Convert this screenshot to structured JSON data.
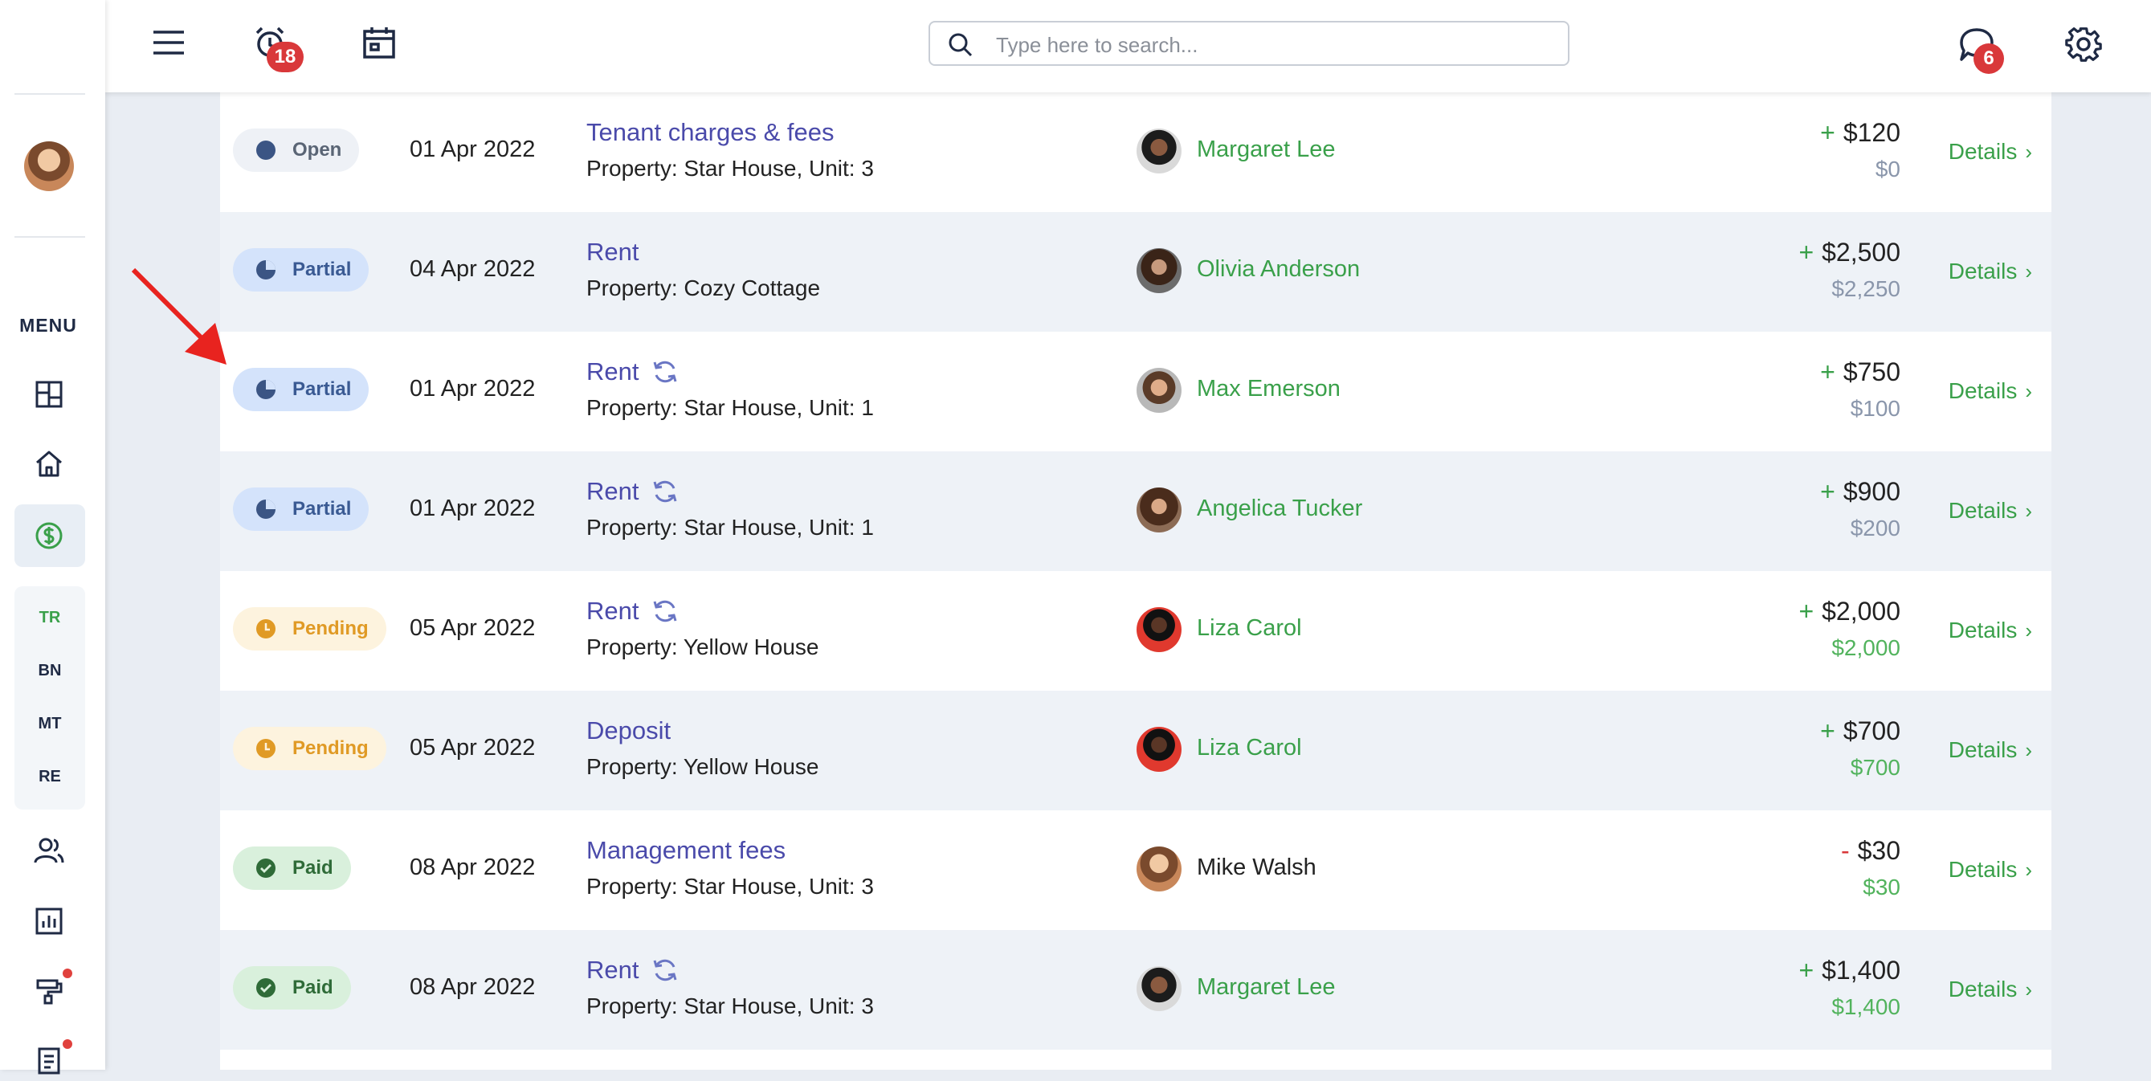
{
  "header": {
    "search_placeholder": "Type here to search...",
    "alerts_count": "18",
    "messages_count": "6"
  },
  "sidebar": {
    "menu_label": "MENU",
    "sub_items": [
      "TR",
      "BN",
      "MT",
      "RE"
    ]
  },
  "transactions": [
    {
      "status": "Open",
      "date": "01 Apr 2022",
      "title": "Tenant charges & fees",
      "recurring": false,
      "property": "Property: Star House, Unit: 3",
      "tenant": "Margaret Lee",
      "sign": "+",
      "amount": "$120",
      "balance": "$0",
      "details": "Details"
    },
    {
      "status": "Partial",
      "date": "04 Apr 2022",
      "title": "Rent",
      "recurring": false,
      "property": "Property: Cozy Cottage",
      "tenant": "Olivia Anderson",
      "sign": "+",
      "amount": "$2,500",
      "balance": "$2,250",
      "details": "Details"
    },
    {
      "status": "Partial",
      "date": "01 Apr 2022",
      "title": "Rent",
      "recurring": true,
      "property": "Property: Star House, Unit: 1",
      "tenant": "Max Emerson",
      "sign": "+",
      "amount": "$750",
      "balance": "$100",
      "details": "Details"
    },
    {
      "status": "Partial",
      "date": "01 Apr 2022",
      "title": "Rent",
      "recurring": true,
      "property": "Property: Star House, Unit: 1",
      "tenant": "Angelica Tucker",
      "sign": "+",
      "amount": "$900",
      "balance": "$200",
      "details": "Details"
    },
    {
      "status": "Pending",
      "date": "05 Apr 2022",
      "title": "Rent",
      "recurring": true,
      "property": "Property: Yellow House",
      "tenant": "Liza Carol",
      "sign": "+",
      "amount": "$2,000",
      "balance": "$2,000",
      "details": "Details"
    },
    {
      "status": "Pending",
      "date": "05 Apr 2022",
      "title": "Deposit",
      "recurring": false,
      "property": "Property: Yellow House",
      "tenant": "Liza Carol",
      "sign": "+",
      "amount": "$700",
      "balance": "$700",
      "details": "Details"
    },
    {
      "status": "Paid",
      "date": "08 Apr 2022",
      "title": "Management fees",
      "recurring": false,
      "property": "Property: Star House, Unit: 3",
      "tenant": "Mike Walsh",
      "sign": "-",
      "amount": "$30",
      "balance": "$30",
      "details": "Details"
    },
    {
      "status": "Paid",
      "date": "08 Apr 2022",
      "title": "Rent",
      "recurring": true,
      "property": "Property: Star House, Unit: 3",
      "tenant": "Margaret Lee",
      "sign": "+",
      "amount": "$1,400",
      "balance": "$1,400",
      "details": "Details"
    }
  ],
  "colors": {
    "accent_green": "#3aa04a",
    "link_purple": "#4a4aaa",
    "badge_red": "#d9383a",
    "annotation_arrow": "#e8231f"
  }
}
